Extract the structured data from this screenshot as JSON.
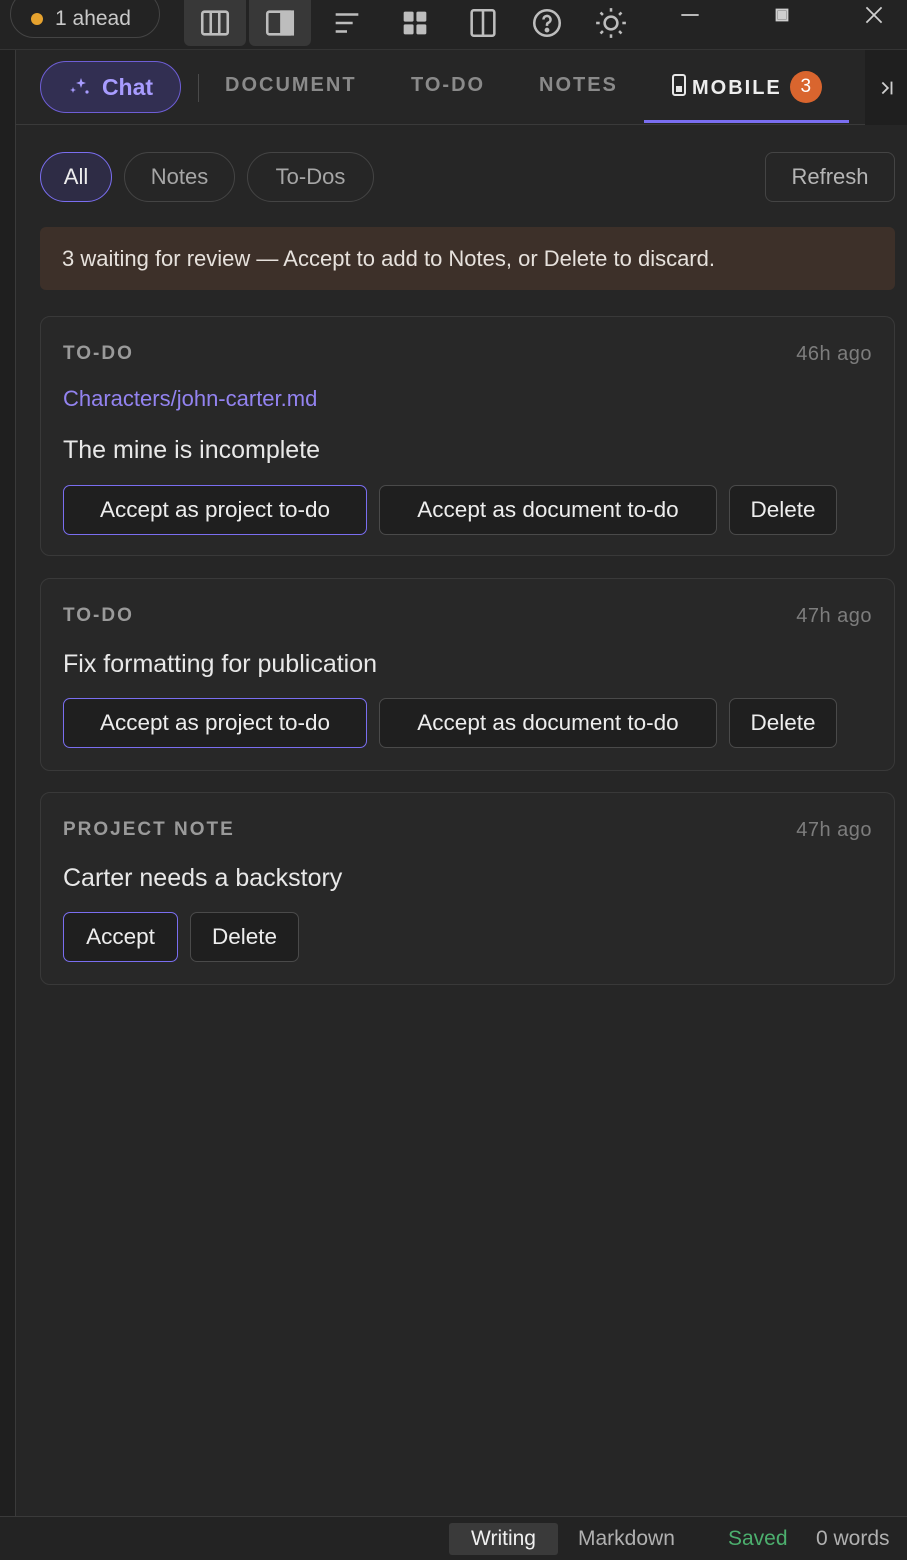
{
  "titlebar": {
    "ahead_label": "1 ahead",
    "tool_icons": [
      "columns-icon",
      "panel-right-icon",
      "align-left-icon",
      "grid-icon",
      "split-view-icon",
      "help-icon",
      "sun-icon"
    ],
    "window_icons": [
      "minimize-icon",
      "restore-icon",
      "close-icon"
    ]
  },
  "tabs": {
    "chat_label": "Chat",
    "items": [
      {
        "label": "DOCUMENT"
      },
      {
        "label": "TO-DO"
      },
      {
        "label": "NOTES"
      },
      {
        "label": "MOBILE",
        "badge": "3",
        "active": true
      }
    ]
  },
  "filters": {
    "all": "All",
    "notes": "Notes",
    "todos": "To-Dos",
    "refresh": "Refresh"
  },
  "banner": {
    "text": "3 waiting for review — Accept to add to Notes, or Delete to discard."
  },
  "cards": [
    {
      "kind": "TO-DO",
      "time": "46h ago",
      "link": "Characters/john-carter.md",
      "text": "The mine is incomplete",
      "buttons": [
        "Accept as project to-do",
        "Accept as document to-do",
        "Delete"
      ]
    },
    {
      "kind": "TO-DO",
      "time": "47h ago",
      "text": "Fix formatting for publication",
      "buttons": [
        "Accept as project to-do",
        "Accept as document to-do",
        "Delete"
      ]
    },
    {
      "kind": "PROJECT NOTE",
      "time": "47h ago",
      "text": "Carter needs a backstory",
      "buttons": [
        "Accept",
        "Delete"
      ]
    }
  ],
  "statusbar": {
    "writing": "Writing",
    "markdown": "Markdown",
    "saved": "Saved",
    "words": "0 words"
  },
  "colors": {
    "accent": "#7a6ef0",
    "badge": "#d9652e",
    "saved": "#4caf6e",
    "banner_bg": "#3d3029"
  }
}
